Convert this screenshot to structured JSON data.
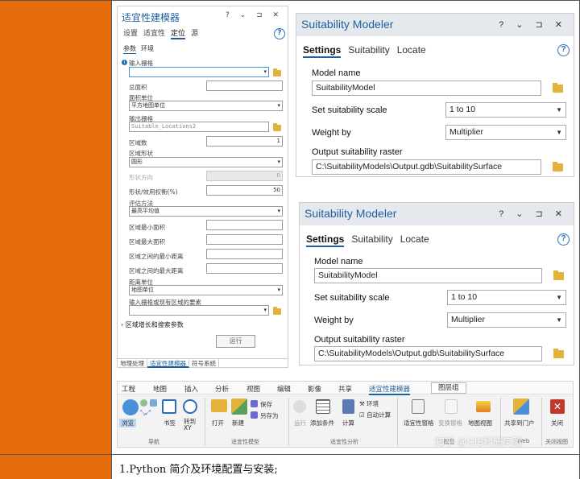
{
  "cn_pane": {
    "title": "适宜性建模器",
    "controls": "? ⌄ ⊐ ✕",
    "tabs": [
      "设置",
      "适宜性",
      "定位",
      "源"
    ],
    "subtabs": [
      "参数",
      "环境"
    ],
    "fields": {
      "input_raster_label": "输入栅格",
      "total_area_label": "总面积",
      "area_units_label": "面积单位",
      "area_units_value": "平方地图单位",
      "output_raster_label": "输出栅格",
      "output_raster_value": "Suitable_Locations2",
      "num_regions_label": "区域数",
      "num_regions_value": "1",
      "region_shape_label": "区域形状",
      "region_shape_value": "圆形",
      "shape_orientation_label": "形状方向",
      "shape_orientation_value": "0",
      "shape_weight_label": "形状/效用权衡(%)",
      "shape_weight_value": "50",
      "eval_method_label": "评估方法",
      "eval_method_value": "最高平均值",
      "min_area_label": "区域最小面积",
      "max_area_label": "区域最大面积",
      "min_dist_label": "区域之间的最小距离",
      "max_dist_label": "区域之间的最大距离",
      "dist_units_label": "距离单位",
      "dist_units_value": "地图单位",
      "existing_regions_label": "输入栅格或现有区域的要素",
      "growth_section": "区域增长和搜索参数"
    },
    "run_label": "运行",
    "bottom_tabs": [
      "地理处理",
      "适宜性建模器",
      "符号系统"
    ]
  },
  "en_pane_1": {
    "title": "Suitability Modeler",
    "controls": "? ⌄ ⊐ ✕",
    "tabs": [
      "Settings",
      "Suitability",
      "Locate"
    ],
    "model_name_label": "Model name",
    "model_name_value": "SuitabilityModel",
    "scale_label": "Set suitability scale",
    "scale_value": "1 to 10",
    "weight_label": "Weight by",
    "weight_value": "Multiplier",
    "output_label": "Output suitability raster",
    "output_value": "C:\\SuitabilityModels\\Output.gdb\\SuitabilitySurface"
  },
  "en_pane_2": {
    "title": "Suitability Modeler",
    "controls": "? ⌄ ⊐ ✕",
    "tabs": [
      "Settings",
      "Suitability",
      "Locate"
    ],
    "model_name_label": "Model name",
    "model_name_value": "SuitabilityModel",
    "scale_label": "Set suitability scale",
    "scale_value": "1 to 10",
    "weight_label": "Weight by",
    "weight_value": "Multiplier",
    "output_label": "Output suitability raster",
    "output_value": "C:\\SuitabilityModels\\Output.gdb\\SuitabilitySurface"
  },
  "ribbon": {
    "tabs": [
      "工程",
      "地图",
      "插入",
      "分析",
      "视图",
      "编辑",
      "影像",
      "共享",
      "适宜性建模器",
      "图层组"
    ],
    "buttons": {
      "browse": "浏览",
      "bookmarks": "书签",
      "goto_xy": "转到 XY",
      "open": "打开",
      "new": "新建",
      "save": "保存",
      "save_as": "另存为",
      "run": "运行",
      "add_criteria": "添加条件",
      "calculate": "计算",
      "environment": "环境",
      "auto_calculate": "自动计算",
      "suitability_pane": "适宜性窗格",
      "transform_pane": "变换窗格",
      "map_view": "地图视图",
      "share_portal": "共享到门户",
      "close": "关闭"
    },
    "groups": [
      "导航",
      "适宜性模型",
      "适宜性分析",
      "视图",
      "Web",
      "关闭视图"
    ]
  },
  "bottom_text": "1.Python 简介及环境配置与安装;",
  "watermark": "知乎 @GIS科研实验"
}
